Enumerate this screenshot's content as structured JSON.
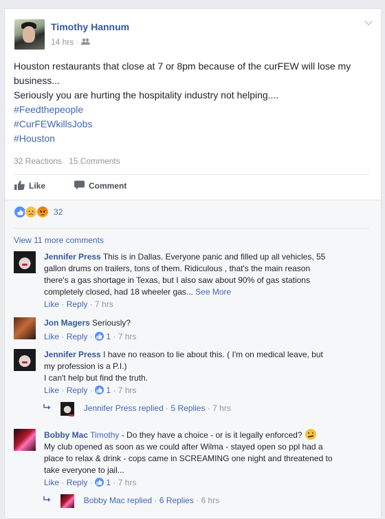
{
  "post": {
    "author": "Timothy Hannum",
    "time": "14 hrs",
    "meta_sep": "·",
    "audience_icon": "friends-icon",
    "text_lines": [
      "Houston restaurants that close at 7 or 8pm because of the curFEW will lose my",
      "business...",
      "Seriously you are hurting the hospitality industry not helping...."
    ],
    "hashtags": [
      "#Feedthepeople",
      "#CurFEWkillsJobs",
      "#Houston"
    ],
    "reactions_count_label": "32 Reactions",
    "comments_count_label": "15 Comments"
  },
  "actions": {
    "like": "Like",
    "comment": "Comment"
  },
  "reactions_bar": {
    "count": "32",
    "icons": [
      "like-reaction-icon",
      "sad-reaction-icon",
      "angry-reaction-icon"
    ]
  },
  "view_more": "View 11 more comments",
  "comments": [
    {
      "author": "Jennifer Press",
      "lines": [
        "This is in Dallas. Everyone panic and filled up all vehicles, 55",
        "gallon drums on trailers, tons of them. Ridiculous , that's the main reason",
        "there's a gas shortage in Texas, but I also saw about 90% of gas stations",
        "completely closed, had 18 wheeler gas..."
      ],
      "see_more": "See More",
      "like": "Like",
      "reply": "Reply",
      "time": "7 hrs",
      "likes": ""
    },
    {
      "author": "Jon Magers",
      "lines": [
        "Seriously?"
      ],
      "like": "Like",
      "reply": "Reply",
      "time": "7 hrs",
      "likes": "1"
    },
    {
      "author": "Jennifer Press",
      "lines": [
        "I have no reason to lie about this. ( I'm on medical leave, but",
        "my profession is a P.I.)",
        "I can't help but find the truth."
      ],
      "like": "Like",
      "reply": "Reply",
      "time": "7 hrs",
      "likes": "1",
      "replied_label": "Jennifer Press replied",
      "replies": "5 Replies",
      "replied_time": "7 hrs"
    },
    {
      "author": "Bobby Mac",
      "mention": "Timothy",
      "lines": [
        "- Do they have a choice - or is it legally enforced?",
        "My club opened as soon as we could after Wilma - stayed open so ppl had a",
        "place to relax & drink - cops came in SCREAMING one night and threatened to",
        "take everyone to jail..."
      ],
      "like": "Like",
      "reply": "Reply",
      "time": "7 hrs",
      "likes": "1",
      "replied_label": "Bobby Mac replied",
      "replies": "6 Replies",
      "replied_time": "6 hrs"
    }
  ],
  "colors": {
    "link": "#4267b2",
    "name": "#365899",
    "meta": "#90949c",
    "bg": "#e9ebee"
  }
}
